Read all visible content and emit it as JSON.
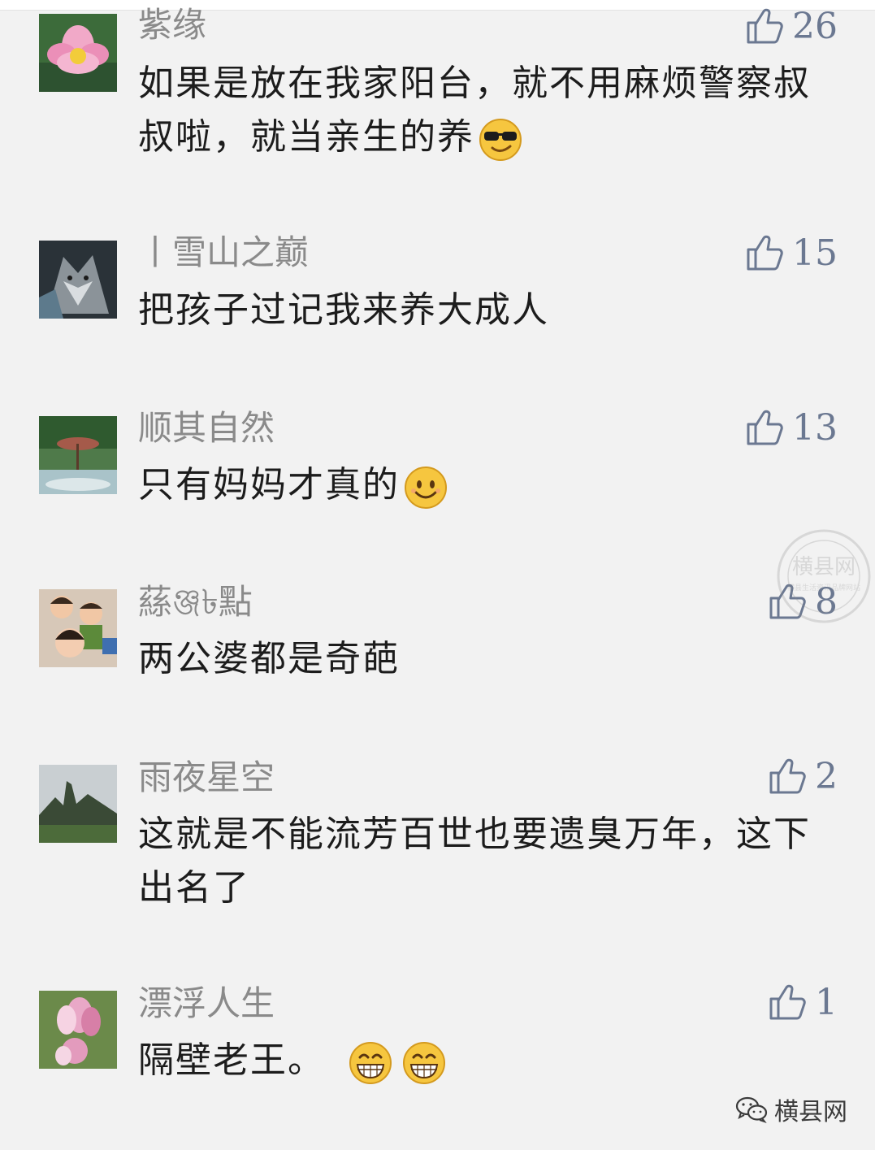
{
  "comments": [
    {
      "nickname": "紫缘",
      "likes": "26",
      "text": "如果是放在我家阳台，就不用麻烦警察叔叔啦，就当亲生的养",
      "emoji": "sunglasses-emoji"
    },
    {
      "nickname": "丨雪山之巅",
      "likes": "15",
      "text": "把孩子过记我来养大成人",
      "emoji": ""
    },
    {
      "nickname": "顺其自然",
      "likes": "13",
      "text": "只有妈妈才真的",
      "emoji": "smile-emoji"
    },
    {
      "nickname": "蕬ঞ্জ৳點",
      "likes": "8",
      "text": "两公婆都是奇葩",
      "emoji": ""
    },
    {
      "nickname": "雨夜星空",
      "likes": "2",
      "text": "这就是不能流芳百世也要遗臭万年，这下出名了",
      "emoji": ""
    },
    {
      "nickname": "漂浮人生",
      "likes": "1",
      "text": "隔壁老王。",
      "emoji": "grin-emoji"
    }
  ],
  "brand": {
    "label": "横县网",
    "icon": "wechat-icon"
  },
  "watermark": {
    "text": "横县网",
    "subtext": "横县生活资讯品牌网站"
  },
  "colors": {
    "background": "#f2f2f2",
    "nickname": "#8a8a8a",
    "like": "#6b7891",
    "text": "#1c1c1c"
  }
}
